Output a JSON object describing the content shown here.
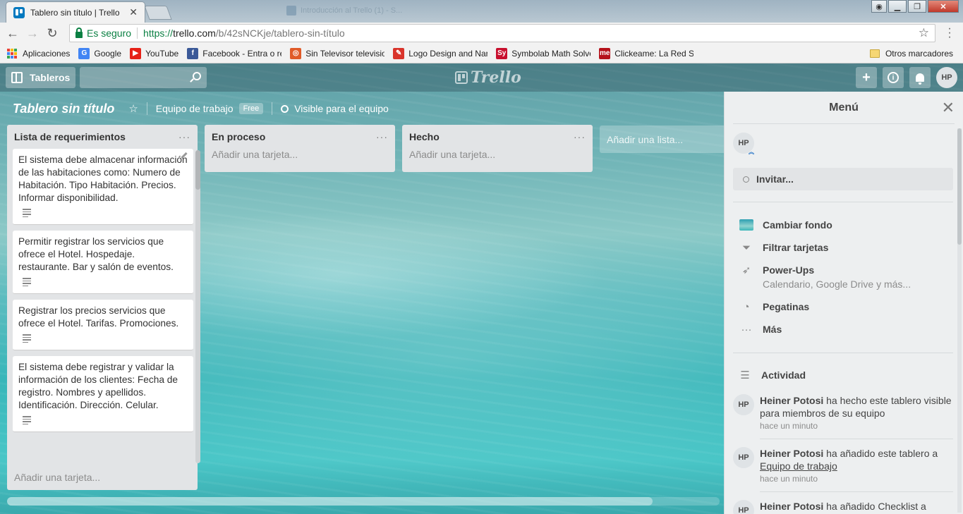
{
  "browser": {
    "tab_title": "Tablero sin título | Trello",
    "tab_close": "✕",
    "ghost_tab_title": "Introducción al Trello (1) - S...",
    "secure_label": "Es seguro",
    "url_scheme": "https://",
    "url_host": "trello.com",
    "url_path": "/b/42sNCKje/tablero-sin-título"
  },
  "bookmarks": {
    "apps": "Aplicaciones",
    "items": [
      {
        "label": "Google",
        "icon": "google-icon",
        "color": "#4285f4",
        "glyph": "G"
      },
      {
        "label": "YouTube",
        "icon": "youtube-icon",
        "color": "#e62117",
        "glyph": "▶"
      },
      {
        "label": "Facebook - Entra o re",
        "icon": "facebook-icon",
        "color": "#3b5998",
        "glyph": "f"
      },
      {
        "label": "Sin Televisor televisio",
        "icon": "tv-icon",
        "color": "#e05a28",
        "glyph": "◎"
      },
      {
        "label": "Logo Design and Nar",
        "icon": "logo-design-icon",
        "color": "#d9342b",
        "glyph": "✎"
      },
      {
        "label": "Symbolab Math Solve",
        "icon": "symbolab-icon",
        "color": "#c8102e",
        "glyph": "Sy"
      },
      {
        "label": "Clickeame: La Red So",
        "icon": "clickeame-icon",
        "color": "#b5121b",
        "glyph": "me"
      }
    ],
    "other": "Otros marcadores"
  },
  "header": {
    "boards_label": "Tableros",
    "logo_text": "Trello",
    "add_glyph": "+",
    "info_glyph": "i",
    "user_initials": "HP"
  },
  "board": {
    "title": "Tablero sin título",
    "star": "☆",
    "team": "Equipo de trabajo",
    "plan": "Free",
    "visibility": "Visible para el equipo",
    "add_list": "Añadir una lista...",
    "list_menu": "···",
    "lists": [
      {
        "name": "Lista de requerimientos",
        "add_card": "Añadir una tarjeta...",
        "cards": [
          "El sistema debe almacenar información de las habitaciones como: Numero de Habitación. Tipo Habitación. Precios. Informar disponibilidad.",
          "Permitir registrar los servicios que ofrece el Hotel. Hospedaje. restaurante. Bar y salón de eventos.",
          "Registrar los precios servicios que ofrece el Hotel. Tarifas. Promociones.",
          "El sistema debe registrar y validar la información de los clientes: Fecha de registro. Nombres y apellidos. Identificación. Dirección. Celular."
        ]
      },
      {
        "name": "En proceso",
        "add_card": "Añadir una tarjeta...",
        "cards": []
      },
      {
        "name": "Hecho",
        "add_card": "Añadir una tarjeta...",
        "cards": []
      }
    ]
  },
  "menu": {
    "title": "Menú",
    "close": "✕",
    "member_initials": "HP",
    "admin_mark": "︽",
    "invite": "Invitar...",
    "items": [
      {
        "label": "Cambiar fondo",
        "sub": ""
      },
      {
        "label": "Filtrar tarjetas",
        "sub": ""
      },
      {
        "label": "Power-Ups",
        "sub": "Calendario, Google Drive y más..."
      },
      {
        "label": "Pegatinas",
        "sub": ""
      },
      {
        "label": "Más",
        "sub": ""
      }
    ],
    "activity_title": "Actividad",
    "activity": [
      {
        "initials": "HP",
        "user": "Heiner Potosi",
        "text": " ha hecho este tablero visible para miembros de su equipo",
        "link": "",
        "time": "hace un minuto"
      },
      {
        "initials": "HP",
        "user": "Heiner Potosi",
        "text": " ha añadido este tablero a ",
        "link": "Equipo de trabajo",
        "time": "hace un minuto"
      },
      {
        "initials": "HP",
        "user": "Heiner Potosi",
        "text": " ha añadido Checklist a",
        "link": "",
        "time": ""
      }
    ]
  }
}
